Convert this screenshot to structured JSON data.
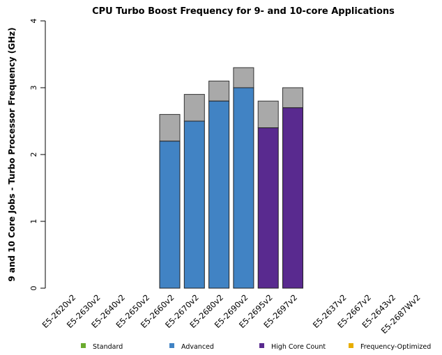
{
  "chart_data": {
    "type": "bar",
    "stacked": true,
    "title": "CPU Turbo Boost Frequency for 9- and 10-core Applications",
    "xlabel": "",
    "ylabel": "9 and 10 Core Jobs - Turbo Processor Frequency (GHz)",
    "ylim": [
      0,
      4
    ],
    "yticks": [
      "0",
      "1",
      "2",
      "3",
      "4"
    ],
    "grid": false,
    "legend_placement": "bottom",
    "categories": [
      "E5-2620v2",
      "E5-2630v2",
      "E5-2640v2",
      "E5-2650v2",
      "E5-2660v2",
      "E5-2670v2",
      "E5-2680v2",
      "E5-2690v2",
      "E5-2695v2",
      "E5-2697v2",
      "",
      "E5-2637v2",
      "E5-2667v2",
      "E5-2643v2",
      "E5-2687Wv2"
    ],
    "base_values": [
      null,
      null,
      null,
      null,
      2.2,
      2.5,
      2.8,
      3.0,
      2.4,
      2.7,
      null,
      null,
      null,
      null,
      null
    ],
    "turbo_values": [
      null,
      null,
      null,
      null,
      2.6,
      2.9,
      3.1,
      3.3,
      2.8,
      3.0,
      null,
      null,
      null,
      null,
      null
    ],
    "groups": [
      "Standard",
      "Standard",
      "Standard",
      "Standard",
      "Advanced",
      "Advanced",
      "Advanced",
      "Advanced",
      "High Core Count",
      "High Core Count",
      "",
      "Frequency-Optimized",
      "Frequency-Optimized",
      "Frequency-Optimized",
      "Frequency-Optimized"
    ],
    "turbo_color": "#a9a9a9",
    "legend": [
      {
        "name": "Standard",
        "color": "#6aab2e"
      },
      {
        "name": "Advanced",
        "color": "#4183c4"
      },
      {
        "name": "High Core Count",
        "color": "#592a8f"
      },
      {
        "name": "Frequency-Optimized",
        "color": "#e8ad00"
      }
    ]
  }
}
